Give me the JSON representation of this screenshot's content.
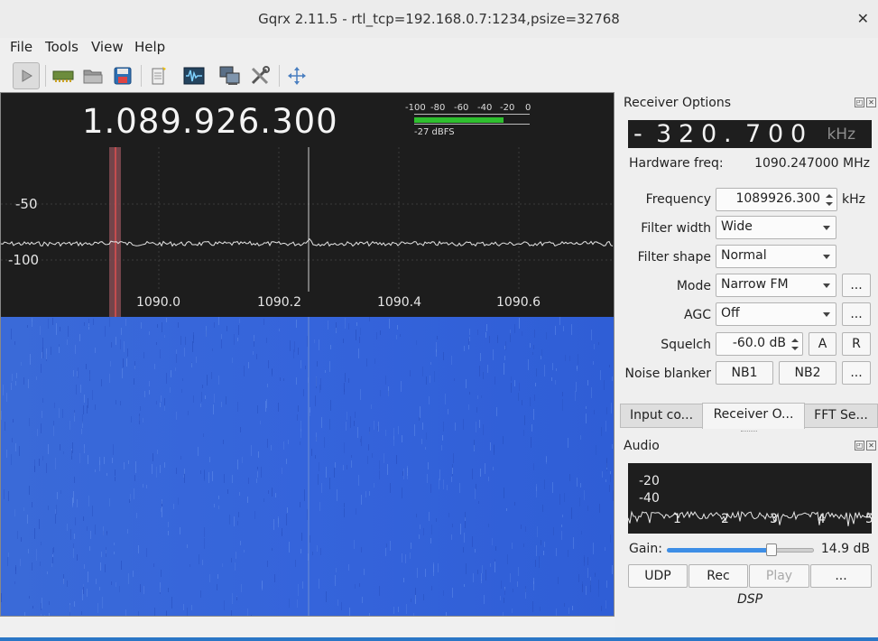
{
  "window": {
    "title": "Gqrx 2.11.5 - rtl_tcp=192.168.0.7:1234,psize=32768",
    "close_glyph": "✕"
  },
  "menu": [
    "File",
    "Tools",
    "View",
    "Help"
  ],
  "toolbar_icons": [
    "play-icon",
    "hardware-icon",
    "open-icon",
    "save-icon",
    "bookmark-icon",
    "waveform-icon",
    "remote-control-icon",
    "tools-icon",
    "fullscreen-icon"
  ],
  "spectrum": {
    "frequency_display": "1.089.926.300",
    "level_meter": {
      "ticks": [
        "-100",
        "-80",
        "-60",
        "-40",
        "-20",
        "0"
      ],
      "readout": "-27 dBFS",
      "fill_fraction": 0.77
    },
    "y_ticks": [
      "-50",
      "-100"
    ],
    "x_ticks": [
      "1090.0",
      "1090.2",
      "1090.4",
      "1090.6"
    ]
  },
  "receiver": {
    "header": "Receiver Options",
    "offset_digits": [
      "-",
      "3",
      "2",
      "0",
      ".",
      "7",
      "0",
      "0"
    ],
    "offset_unit": "kHz",
    "hw_freq_label": "Hardware freq:",
    "hw_freq_value": "1090.247000 MHz",
    "frequency_label": "Frequency",
    "frequency_value": "1089926.300",
    "frequency_unit": "kHz",
    "filter_width_label": "Filter width",
    "filter_width_value": "Wide",
    "filter_shape_label": "Filter shape",
    "filter_shape_value": "Normal",
    "mode_label": "Mode",
    "mode_value": "Narrow FM",
    "agc_label": "AGC",
    "agc_value": "Off",
    "squelch_label": "Squelch",
    "squelch_value": "-60.0 dB",
    "squelch_a": "A",
    "squelch_r": "R",
    "nb_label": "Noise blanker",
    "nb1": "NB1",
    "nb2": "NB2",
    "more": "..."
  },
  "tabs": [
    "Input co...",
    "Receiver O...",
    "FFT Se..."
  ],
  "audio": {
    "header": "Audio",
    "y_ticks": [
      "-20",
      "-40"
    ],
    "x_ticks": [
      "1",
      "2",
      "3",
      "4",
      "5"
    ],
    "gain_label": "Gain:",
    "gain_value": "14.9 dB",
    "gain_fraction": 0.71,
    "buttons": [
      "UDP",
      "Rec",
      "Play",
      "..."
    ],
    "dsp_label": "DSP"
  },
  "colors": {
    "accent": "#3d8ee6",
    "waterfall": "#2f5fd9",
    "meter": "#2fbf2f"
  }
}
